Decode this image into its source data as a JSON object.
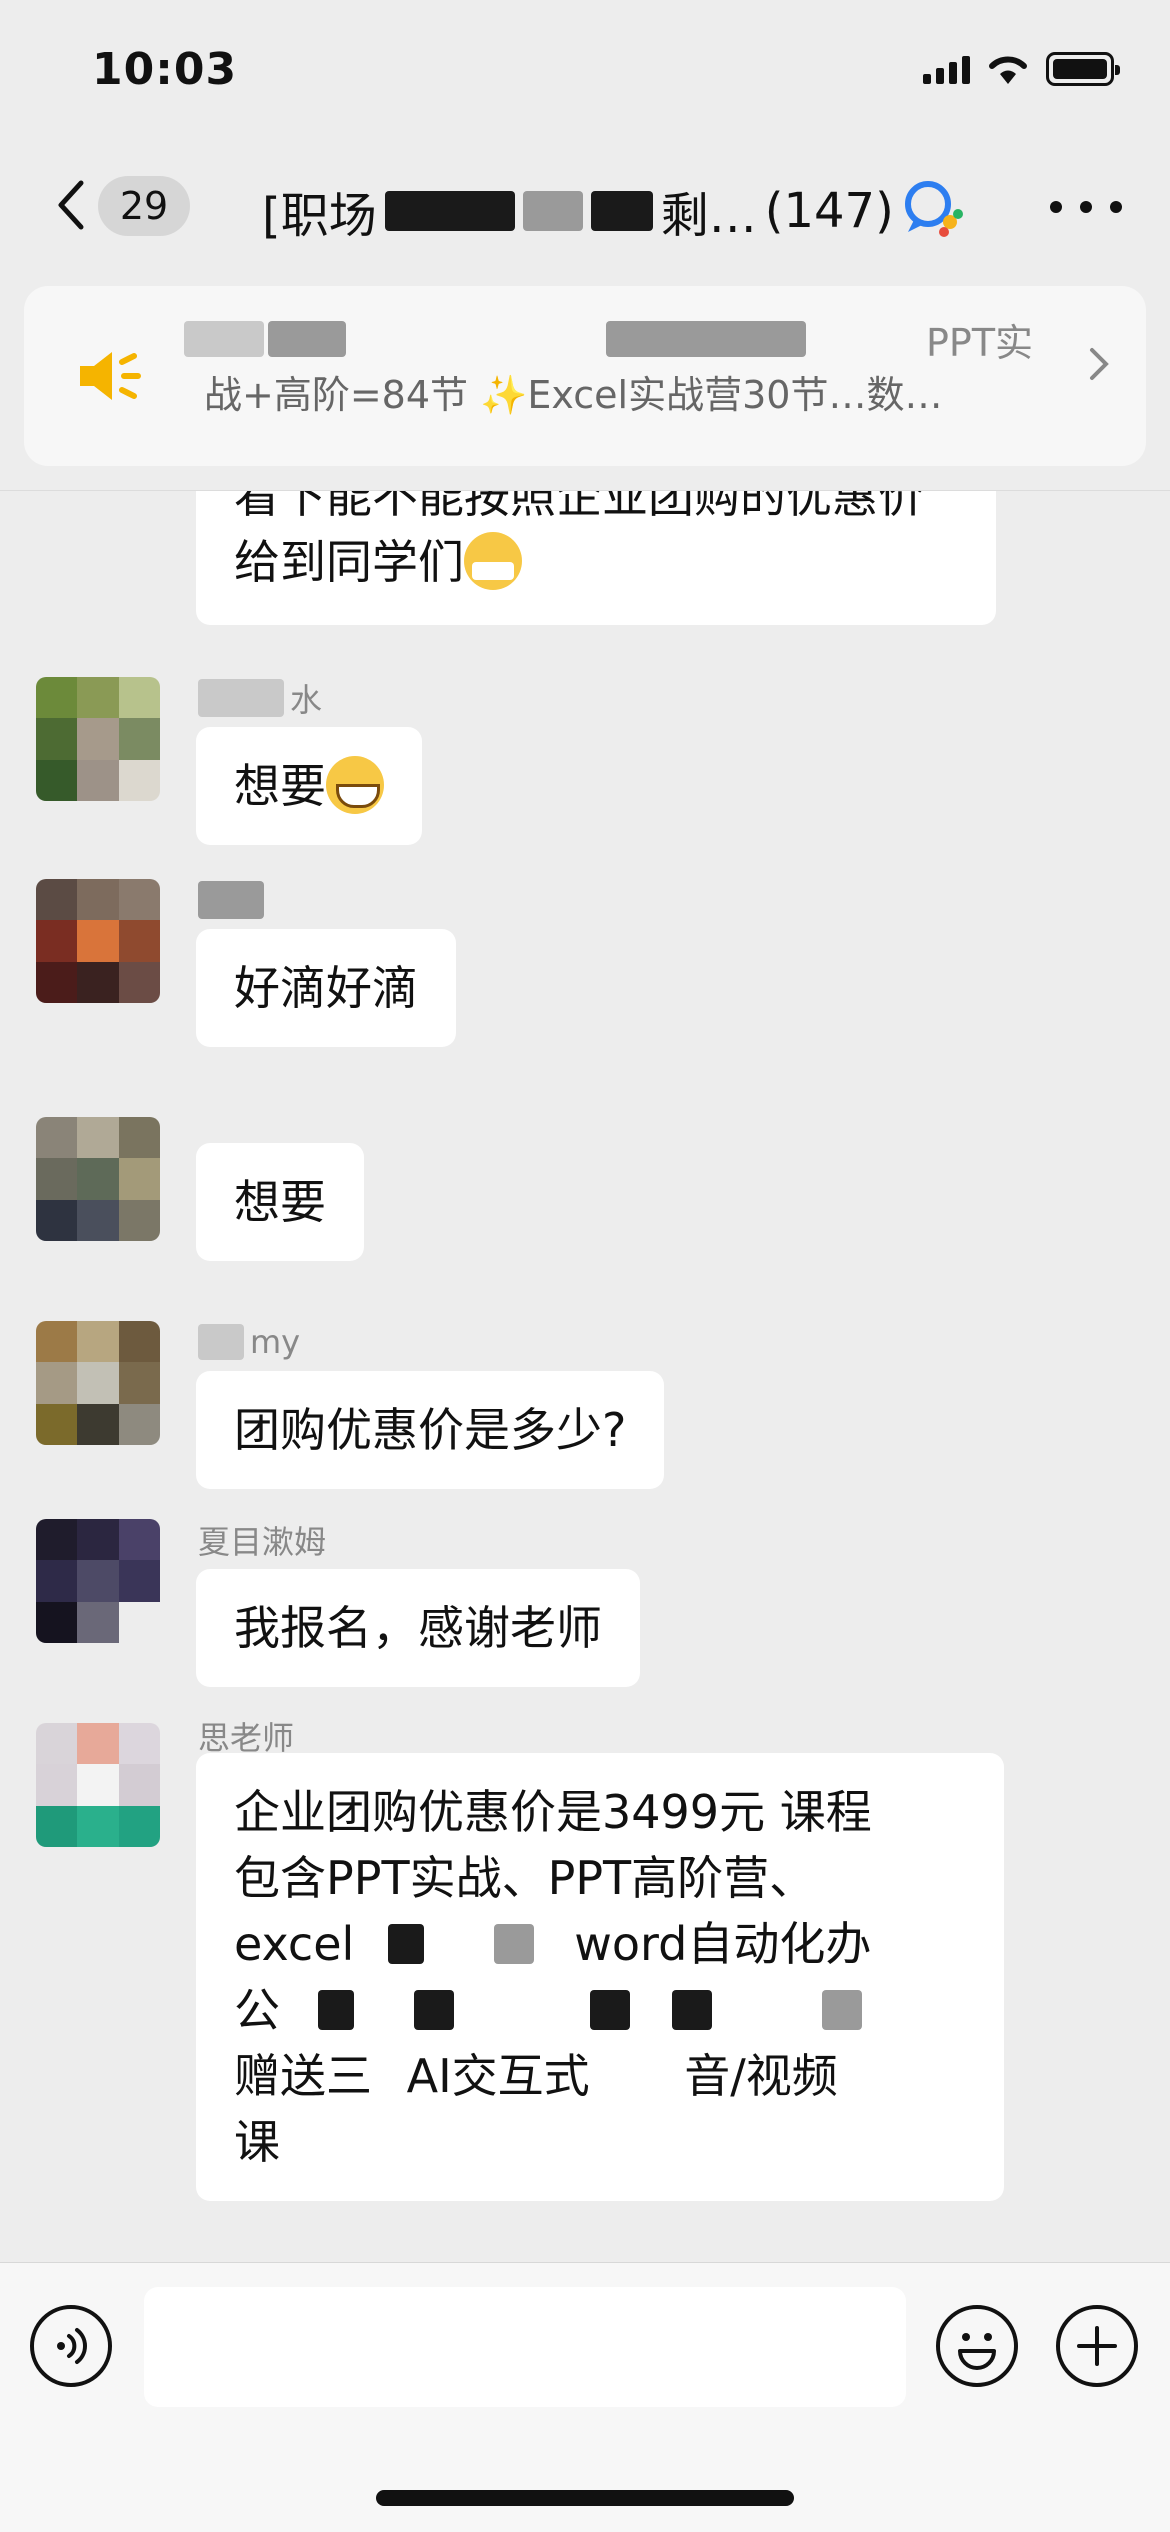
{
  "status": {
    "time": "10:03"
  },
  "nav": {
    "unread_count": "29",
    "title_prefix": "[职场",
    "title_middle": "剩…",
    "member_count": "(147)"
  },
  "announcement": {
    "line1_suffix": "PPT实",
    "line2": "战+高阶=84节 ✨Excel实战营30节…数…"
  },
  "messages": [
    {
      "sender": "",
      "text": "看下能不能按照企业团购的优惠价给到同学们",
      "emoji": "mask"
    },
    {
      "sender": "水",
      "text": "想要",
      "emoji": "grin"
    },
    {
      "sender": "",
      "text": "好滴好滴",
      "emoji": ""
    },
    {
      "sender": "",
      "text": "想要",
      "emoji": ""
    },
    {
      "sender": "my",
      "text": "团购优惠价是多少?",
      "emoji": ""
    },
    {
      "sender": "夏目漱姆",
      "text": "我报名，感谢老师",
      "emoji": ""
    },
    {
      "sender": "思老师",
      "text_lines": [
        "企业团购优惠价是3499元 课程",
        "包含PPT实战、PPT高阶营、",
        "excel",
        "word自动化办",
        "公",
        "赠送三",
        "AI交互式",
        "音/视频",
        "课"
      ],
      "emoji": ""
    }
  ],
  "input": {
    "placeholder": ""
  }
}
